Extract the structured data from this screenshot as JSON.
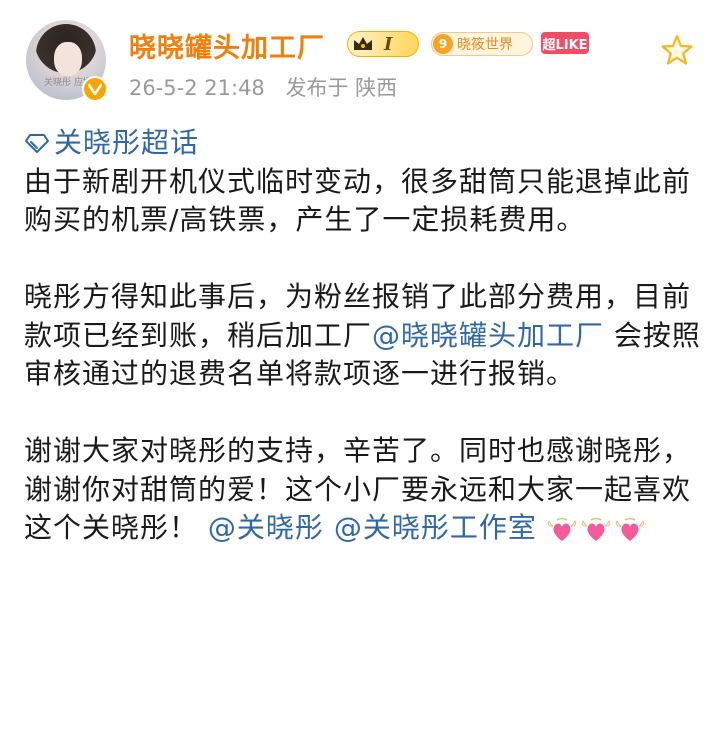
{
  "user": {
    "name": "晓晓罐头加工厂",
    "avatar_label": "关晓彤 应援站",
    "level": "I",
    "world_badge": {
      "number": "9",
      "label": "晓筱世界"
    },
    "like_badge": "超LIKE"
  },
  "meta": {
    "timestamp": "26-5-2 21:48",
    "location": "发布于 陕西"
  },
  "post": {
    "topic": "关晓彤超话",
    "para1": "由于新剧开机仪式临时变动，很多甜筒只能退掉此前购买的机票/高铁票，产生了一定损耗费用。",
    "para2_before": "晓彤方得知此事后，为粉丝报销了此部分费用，目前款项已经到账，稍后加工厂",
    "para2_mention": "@晓晓罐头加工厂",
    "para2_after": " 会按照审核通过的退费名单将款项逐一进行报销。",
    "para3_text": "谢谢大家对晓彤的支持，辛苦了。同时也感谢晓彤，谢谢你对甜筒的爱！这个小厂要永远和大家一起喜欢这个关晓彤！",
    "mention1": "@关晓彤",
    "mention2": "@关晓彤工作室"
  },
  "icons": {
    "verify": "verified-v-icon",
    "star": "star-outline-icon",
    "topic": "diamond-topic-icon",
    "heart": "heart-with-wings-emoji"
  },
  "colors": {
    "username": "#f27f0c",
    "link": "#2f68a8",
    "meta": "#9a9a9a",
    "like_badge": "#f24d66"
  }
}
